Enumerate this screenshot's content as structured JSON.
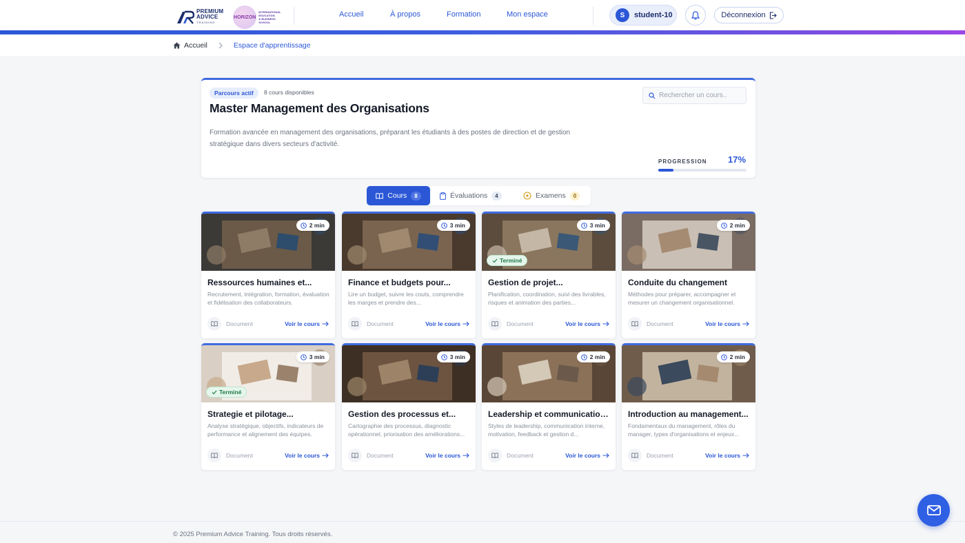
{
  "brand": {
    "logo1_line1": "PREMIUM",
    "logo1_line2": "ADVICE",
    "logo1_line3": "TRAINING",
    "logo2_mark": "HORIZON",
    "logo2_line1": "INTERNATIONAL",
    "logo2_line2": "EDUCATION",
    "logo2_line3": "& BUSINESS",
    "logo2_line4": "SCHOOL"
  },
  "nav": {
    "items": [
      "Accueil",
      "À propos",
      "Formation",
      "Mon espace"
    ]
  },
  "user": {
    "initial": "S",
    "name": "student-10",
    "logout_label": "Déconnexion"
  },
  "breadcrumb": {
    "home": "Accueil",
    "current": "Espace d'apprentissage"
  },
  "program": {
    "tag": "Parcours actif",
    "count": "8 cours disponibles",
    "title": "Master Management des Organisations",
    "description": "Formation avancée en management des organisations, préparant les étudiants à des postes de direction et de gestion stratégique dans divers secteurs d'activité.",
    "search_placeholder": "Rechercher un cours..",
    "progress_label": "PROGRESSION",
    "progress_text": "17%",
    "progress_value": 17
  },
  "tabs": [
    {
      "label": "Cours",
      "count": "8"
    },
    {
      "label": "Évaluations",
      "count": "4"
    },
    {
      "label": "Examens",
      "count": "0"
    }
  ],
  "card_common": {
    "doc_label": "Document",
    "cta_label": "Voir le cours",
    "done_label": "Terminé"
  },
  "courses": [
    {
      "title": "Ressources humaines et...",
      "desc": "Recrutement, intégration, formation, évaluation et fidélisation des collaborateurs.",
      "duration": "2 min",
      "done": false
    },
    {
      "title": "Finance et budgets pour...",
      "desc": "Lire un budget, suivre les couts, comprendre les marges et prendre des...",
      "duration": "3 min",
      "done": false
    },
    {
      "title": "Gestion de projet...",
      "desc": "Planification, coordination, suivi des livrables, risques et animation des parties...",
      "duration": "3 min",
      "done": true
    },
    {
      "title": "Conduite du changement",
      "desc": "Méthodes pour préparer, accompagner et mesurer un changement organisationnel.",
      "duration": "2 min",
      "done": false
    },
    {
      "title": "Strategie et pilotage...",
      "desc": "Analyse stratégique, objectifs, indicateurs de performance et alignement des équipes.",
      "duration": "3 min",
      "done": true
    },
    {
      "title": "Gestion des processus et...",
      "desc": "Cartographie des processus, diagnostic opérationnel, priorisation des améliorations...",
      "duration": "3 min",
      "done": false
    },
    {
      "title": "Leadership et communication...",
      "desc": "Styles de leadership, communication interne, motivation, feedback et gestion d...",
      "duration": "2 min",
      "done": false
    },
    {
      "title": "Introduction au management...",
      "desc": "Fondamentaux du management, rôles du manager, types d'organisations et enjeux...",
      "duration": "2 min",
      "done": false
    }
  ],
  "footer": {
    "copyright": "© 2025 Premium Advice Training. Tous droits réservés."
  },
  "colors": {
    "accent": "#2b57d6",
    "success": "#1f7a45"
  }
}
